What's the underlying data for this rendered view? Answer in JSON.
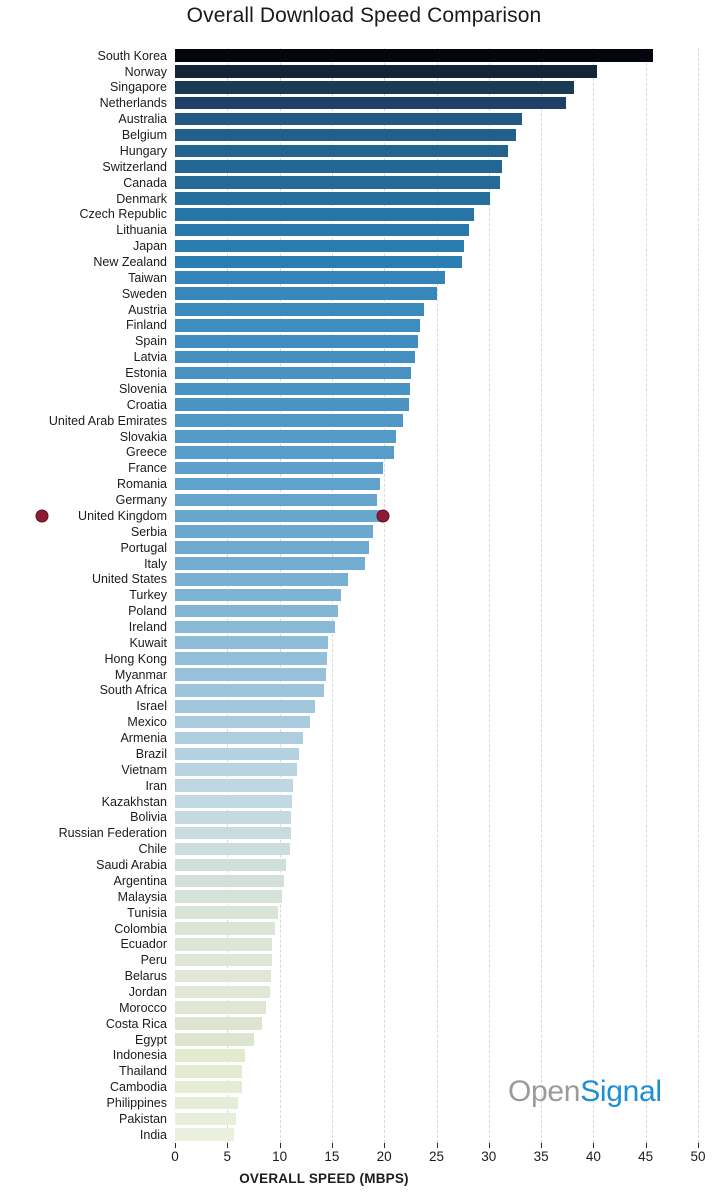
{
  "chart_data": {
    "type": "bar",
    "orientation": "horizontal",
    "title": "Overall Download Speed Comparison",
    "xlabel": "OVERALL SPEED (MBPS)",
    "ylabel": "",
    "xlim": [
      0,
      50
    ],
    "xticks": [
      0,
      5,
      10,
      15,
      20,
      25,
      30,
      35,
      40,
      45,
      50
    ],
    "grid": true,
    "legend": null,
    "highlight": {
      "category": "United Kingdom",
      "marker_color": "#8e1b36",
      "marker_shape": "circle",
      "marker_positions": [
        "label-left",
        "bar-end"
      ]
    },
    "categories": [
      "South Korea",
      "Norway",
      "Singapore",
      "Netherlands",
      "Australia",
      "Belgium",
      "Hungary",
      "Switzerland",
      "Canada",
      "Denmark",
      "Czech Republic",
      "Lithuania",
      "Japan",
      "New Zealand",
      "Taiwan",
      "Sweden",
      "Austria",
      "Finland",
      "Spain",
      "Latvia",
      "Estonia",
      "Slovenia",
      "Croatia",
      "United Arab Emirates",
      "Slovakia",
      "Greece",
      "France",
      "Romania",
      "Germany",
      "United Kingdom",
      "Serbia",
      "Portugal",
      "Italy",
      "United States",
      "Turkey",
      "Poland",
      "Ireland",
      "Kuwait",
      "Hong Kong",
      "Myanmar",
      "South Africa",
      "Israel",
      "Mexico",
      "Armenia",
      "Brazil",
      "Vietnam",
      "Iran",
      "Kazakhstan",
      "Bolivia",
      "Russian Federation",
      "Chile",
      "Saudi Arabia",
      "Argentina",
      "Malaysia",
      "Tunisia",
      "Colombia",
      "Ecuador",
      "Peru",
      "Belarus",
      "Jordan",
      "Morocco",
      "Costa Rica",
      "Egypt",
      "Indonesia",
      "Thailand",
      "Cambodia",
      "Philippines",
      "Pakistan",
      "India"
    ],
    "values": [
      45.7,
      40.3,
      38.1,
      37.4,
      33.2,
      32.6,
      31.8,
      31.3,
      31.1,
      30.1,
      28.6,
      28.1,
      27.6,
      27.4,
      25.8,
      25.0,
      23.8,
      23.4,
      23.2,
      22.9,
      22.6,
      22.5,
      22.4,
      21.8,
      21.1,
      20.9,
      19.9,
      19.6,
      19.3,
      19.9,
      18.9,
      18.5,
      18.2,
      16.5,
      15.9,
      15.6,
      15.3,
      14.6,
      14.5,
      14.4,
      14.2,
      13.4,
      12.9,
      12.2,
      11.9,
      11.7,
      11.3,
      11.2,
      11.1,
      11.1,
      11.0,
      10.6,
      10.4,
      10.2,
      9.8,
      9.6,
      9.3,
      9.3,
      9.2,
      9.1,
      8.7,
      8.3,
      7.6,
      6.7,
      6.4,
      6.4,
      6.0,
      5.8,
      5.6
    ],
    "bar_colors": [
      "#05060d",
      "#152538",
      "#1b3a54",
      "#1f3f66",
      "#225a84",
      "#22608c",
      "#23648f",
      "#246793",
      "#256994",
      "#266e9c",
      "#2775a6",
      "#2878ab",
      "#2a7cb0",
      "#2b7eb2",
      "#3384b8",
      "#3887ba",
      "#3b8abc",
      "#3e8dbe",
      "#408ec0",
      "#438fc0",
      "#4692c2",
      "#4893c3",
      "#4a94c4",
      "#5098c6",
      "#559bc8",
      "#589dc9",
      "#5ea0cb",
      "#61a2cc",
      "#64a4cd",
      "#67a6ce",
      "#6aa8cf",
      "#6eaad0",
      "#72add1",
      "#78b0d2",
      "#7db3d4",
      "#83b6d5",
      "#88b9d7",
      "#8ebcd8",
      "#93bfda",
      "#97c1da",
      "#9cc4db",
      "#a2c7dc",
      "#a8cbde",
      "#aecedf",
      "#b3d1e0",
      "#b9d4e1",
      "#bed7e2",
      "#c2d9e1",
      "#c5dadf",
      "#c8dbde",
      "#cbdddc",
      "#cfdfda",
      "#d2e0d8",
      "#d5e2d7",
      "#d8e4d6",
      "#dae5d6",
      "#dce6d6",
      "#dee7d6",
      "#dfe8d6",
      "#e0e8d6",
      "#dfe6d3",
      "#dde5d1",
      "#dce6cf",
      "#e2ead0",
      "#e3ebd2",
      "#e4ecd4",
      "#e6edd7",
      "#e8eedb",
      "#eaf0de"
    ]
  },
  "branding": {
    "logo_first": "Open",
    "logo_second": "Signal"
  }
}
